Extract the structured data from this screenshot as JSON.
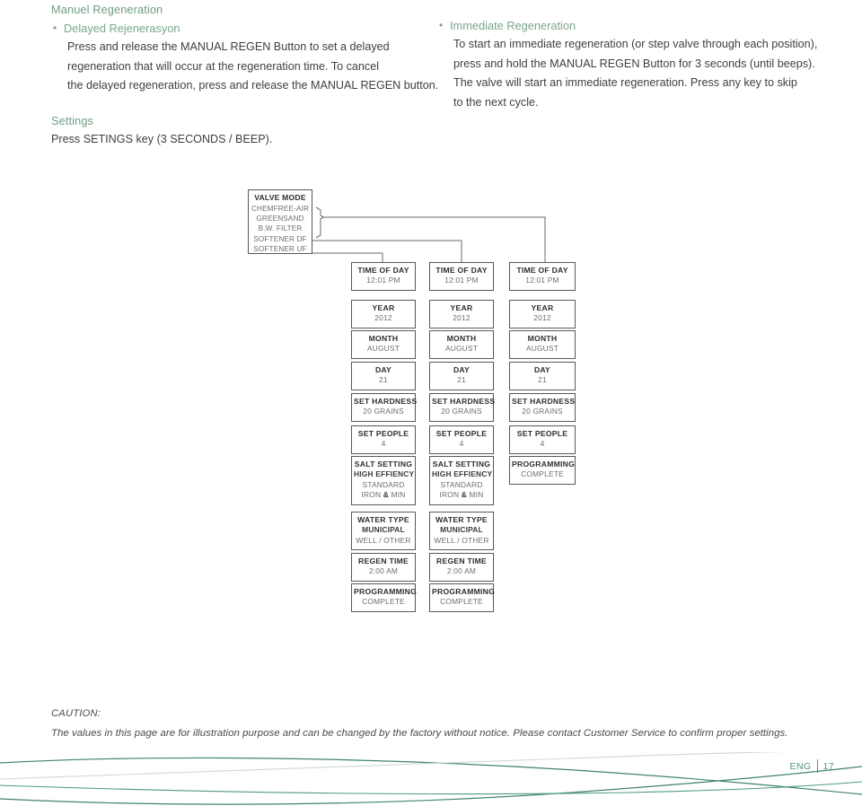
{
  "left_column": {
    "heading": "Manuel Regeneration",
    "bullet_heading": "Delayed Rejenerasyon",
    "body": [
      "Press and release the MANUAL REGEN Button to set a delayed",
      "regeneration that will occur at the regeneration time. To cancel",
      "the delayed regeneration, press and release the MANUAL REGEN button."
    ],
    "settings_heading": "Settings",
    "settings_body": "Press SETINGS key (3 SECONDS / BEEP)."
  },
  "right_column": {
    "bullet_heading": "Immediate Regeneration",
    "body": [
      "To start an immediate regeneration (or step valve through each position),",
      "press and hold the MANUAL REGEN Button for 3 seconds (until beeps).",
      "The valve will start an immediate regeneration. Press any key to skip",
      "to the next cycle."
    ]
  },
  "flowchart": {
    "valve_mode": {
      "title": "VALVE MODE",
      "modes": [
        "CHEMFREE-AIR",
        "GREENSAND",
        "B.W. FILTER",
        "SOFTENER DF",
        "SOFTENER UF"
      ]
    },
    "columns": [
      {
        "id": "softener-uf",
        "nodes": [
          {
            "title": "TIME OF DAY",
            "values": [
              "12:01 PM"
            ]
          },
          {
            "title": "YEAR",
            "values": [
              "2012"
            ]
          },
          {
            "title": "MONTH",
            "values": [
              "AUGUST"
            ]
          },
          {
            "title": "DAY",
            "values": [
              "21"
            ]
          },
          {
            "title": "SET HARDNESS",
            "values": [
              "20 GRAINS"
            ]
          },
          {
            "title": "SET PEOPLE",
            "values": [
              "4"
            ]
          },
          {
            "title": "SALT SETTING",
            "values": [
              "HIGH EFFIENCY",
              "STANDARD",
              "IRON & MIN"
            ]
          },
          {
            "title": "WATER TYPE",
            "values": [
              "MUNICIPAL",
              "WELL / OTHER"
            ]
          },
          {
            "title": "REGEN TIME",
            "values": [
              "2:00 AM"
            ]
          },
          {
            "title": "PROGRAMMING",
            "values": [
              "COMPLETE"
            ]
          }
        ]
      },
      {
        "id": "softener-df",
        "nodes": [
          {
            "title": "TIME OF DAY",
            "values": [
              "12:01 PM"
            ]
          },
          {
            "title": "YEAR",
            "values": [
              "2012"
            ]
          },
          {
            "title": "MONTH",
            "values": [
              "AUGUST"
            ]
          },
          {
            "title": "DAY",
            "values": [
              "21"
            ]
          },
          {
            "title": "SET HARDNESS",
            "values": [
              "20 GRAINS"
            ]
          },
          {
            "title": "SET PEOPLE",
            "values": [
              "4"
            ]
          },
          {
            "title": "SALT SETTING",
            "values": [
              "HIGH EFFIENCY",
              "STANDARD",
              "IRON & MIN"
            ]
          },
          {
            "title": "WATER TYPE",
            "values": [
              "MUNICIPAL",
              "WELL / OTHER"
            ]
          },
          {
            "title": "REGEN TIME",
            "values": [
              "2:00 AM"
            ]
          },
          {
            "title": "PROGRAMMING",
            "values": [
              "COMPLETE"
            ]
          }
        ]
      },
      {
        "id": "filter-modes",
        "nodes": [
          {
            "title": "TIME OF DAY",
            "values": [
              "12:01 PM"
            ]
          },
          {
            "title": "YEAR",
            "values": [
              "2012"
            ]
          },
          {
            "title": "MONTH",
            "values": [
              "AUGUST"
            ]
          },
          {
            "title": "DAY",
            "values": [
              "21"
            ]
          },
          {
            "title": "SET HARDNESS",
            "values": [
              "20 GRAINS"
            ]
          },
          {
            "title": "SET PEOPLE",
            "values": [
              "4"
            ]
          },
          {
            "title": "PROGRAMMING",
            "values": [
              "COMPLETE"
            ]
          }
        ]
      }
    ]
  },
  "caution": {
    "label": "CAUTION:",
    "body": "The values in this page are for illustration purpose and can be changed by the factory without notice. Please contact Customer Service to confirm proper settings."
  },
  "footer": {
    "language": "ENG",
    "page_number": "17"
  },
  "colors": {
    "heading_green": "#6f9e82",
    "footer_green": "#3f8468",
    "box_border": "#58585a",
    "body_text": "#3f3f3f"
  }
}
